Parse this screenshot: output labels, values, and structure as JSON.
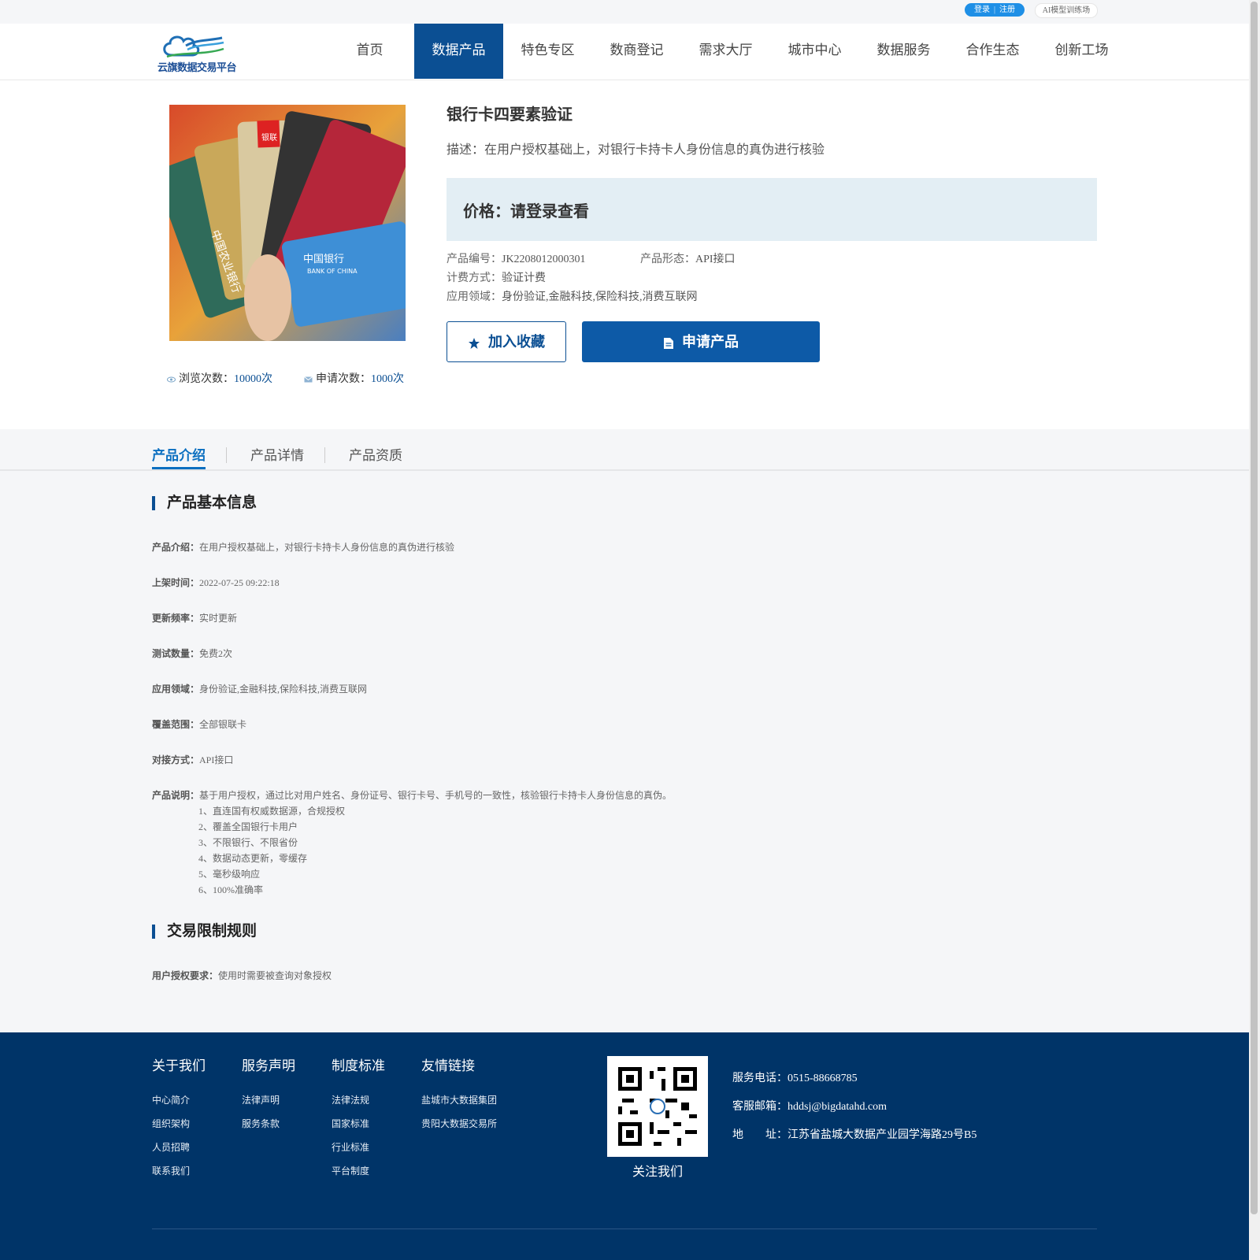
{
  "topbar": {
    "login": "登录",
    "register": "注册",
    "ai_link": "AI模型训练场"
  },
  "header": {
    "logo_text": "云旗数据交易平台"
  },
  "nav": [
    {
      "label": "首页"
    },
    {
      "label": "数据产品",
      "active": true
    },
    {
      "label": "特色专区"
    },
    {
      "label": "数商登记"
    },
    {
      "label": "需求大厅"
    },
    {
      "label": "城市中心"
    },
    {
      "label": "数据服务"
    },
    {
      "label": "合作生态"
    },
    {
      "label": "创新工场"
    }
  ],
  "product": {
    "title": "银行卡四要素验证",
    "desc": "描述：在用户授权基础上，对银行卡持卡人身份信息的真伪进行核验",
    "price": "价格：请登录查看",
    "code_label": "产品编号：",
    "code": "JK2208012000301",
    "form_label": "产品形态：",
    "form": "API接口",
    "billing_label": "计费方式：",
    "billing": "验证计费",
    "field_label": "应用领域：",
    "field": "身份验证,金融科技,保险科技,消费互联网",
    "fav_label": "加入收藏",
    "apply_label": "申请产品",
    "views_label": "浏览次数：",
    "views": "10000次",
    "applies_label": "申请次数：",
    "applies": "1000次",
    "image_card_texts": [
      "中国农业银行",
      "中国银行",
      "BANK OF CHINA",
      "银联"
    ]
  },
  "tabs": [
    {
      "label": "产品介绍",
      "active": true
    },
    {
      "label": "产品详情"
    },
    {
      "label": "产品资质"
    }
  ],
  "basic_info": {
    "title": "产品基本信息",
    "rows": [
      {
        "k": "产品介绍：",
        "v": "在用户授权基础上，对银行卡持卡人身份信息的真伪进行核验"
      },
      {
        "k": "上架时间：",
        "v": "2022-07-25 09:22:18"
      },
      {
        "k": "更新频率：",
        "v": "实时更新"
      },
      {
        "k": "测试数量：",
        "v": "免费2次"
      },
      {
        "k": "应用领域：",
        "v": "身份验证,金融科技,保险科技,消费互联网"
      },
      {
        "k": "覆盖范围：",
        "v": "全部银联卡"
      },
      {
        "k": "对接方式：",
        "v": "API接口"
      },
      {
        "k": "产品说明：",
        "v": "基于用户授权，通过比对用户姓名、身份证号、银行卡号、手机号的一致性，核验银行卡持卡人身份信息的真伪。"
      }
    ],
    "features": [
      "1、直连国有权威数据源，合规授权",
      "2、覆盖全国银行卡用户",
      "3、不限银行、不限省份",
      "4、数据动态更新，零缓存",
      "5、毫秒级响应",
      "6、100%准确率"
    ]
  },
  "rules": {
    "title": "交易限制规则",
    "row": {
      "k": "用户授权要求：",
      "v": "使用时需要被查询对象授权"
    }
  },
  "footer": {
    "cols": [
      {
        "head": "关于我们",
        "links": [
          "中心简介",
          "组织架构",
          "人员招聘",
          "联系我们"
        ]
      },
      {
        "head": "服务声明",
        "links": [
          "法律声明",
          "服务条款"
        ]
      },
      {
        "head": "制度标准",
        "links": [
          "法律法规",
          "国家标准",
          "行业标准",
          "平台制度"
        ]
      },
      {
        "head": "友情链接",
        "links": [
          "盐城市大数据集团",
          "贵阳大数据交易所"
        ]
      }
    ],
    "qr_label": "关注我们",
    "phone_label": "服务电话：",
    "phone": "0515-88668785",
    "email_label": "客服邮箱：",
    "email": "hddsj@bigdatahd.com",
    "addr_label": "地　　址：",
    "addr": "江苏省盐城大数据产业园学海路29号B5"
  }
}
